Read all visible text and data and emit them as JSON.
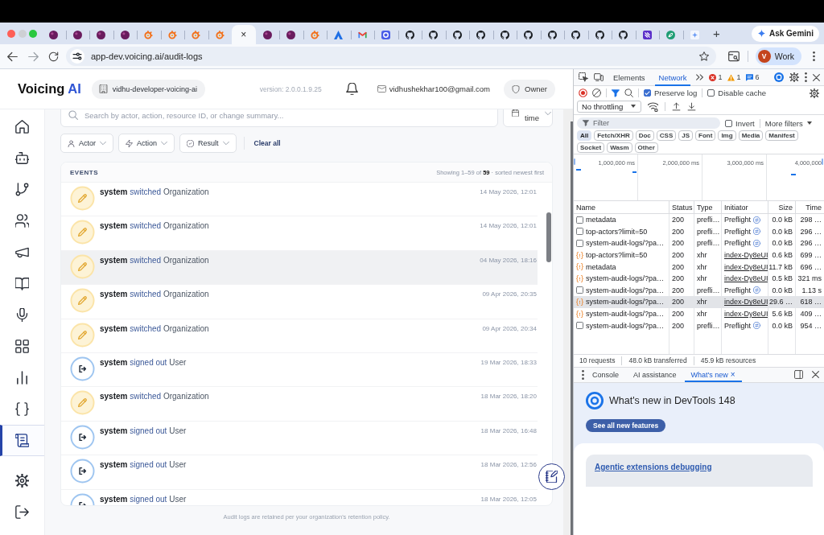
{
  "browser": {
    "tabs": [
      {
        "kind": "orb",
        "selected": false
      },
      {
        "kind": "orb",
        "selected": false
      },
      {
        "kind": "orb",
        "selected": false
      },
      {
        "kind": "orb",
        "selected": false
      },
      {
        "kind": "swirl",
        "selected": false
      },
      {
        "kind": "swirl",
        "selected": false
      },
      {
        "kind": "swirl",
        "selected": false
      },
      {
        "kind": "swirl",
        "selected": false
      },
      {
        "selected": true,
        "close": "×"
      },
      {
        "kind": "orb",
        "selected": false
      },
      {
        "kind": "orb",
        "selected": false
      },
      {
        "kind": "swirl",
        "selected": false
      },
      {
        "kind": "triangle",
        "selected": false
      },
      {
        "kind": "envelope",
        "selected": false
      },
      {
        "kind": "square",
        "selected": false
      },
      {
        "kind": "cat",
        "selected": false
      },
      {
        "kind": "cat",
        "selected": false
      },
      {
        "kind": "cat",
        "selected": false
      },
      {
        "kind": "cat",
        "selected": false
      },
      {
        "kind": "cat",
        "selected": false
      },
      {
        "kind": "cat",
        "selected": false
      },
      {
        "kind": "cat",
        "selected": false
      },
      {
        "kind": "cat",
        "selected": false
      },
      {
        "kind": "cat",
        "selected": false
      },
      {
        "kind": "cat",
        "selected": false
      },
      {
        "kind": "tile",
        "selected": false
      },
      {
        "kind": "leaf",
        "selected": false
      },
      {
        "kind": "sparkle",
        "selected": false
      }
    ],
    "new_tab": "+",
    "assistant": "Ask Gemini",
    "url": "app-dev.voicing.ai/audit-logs",
    "profile": {
      "initial": "V",
      "label": "Work"
    }
  },
  "app": {
    "logo": {
      "text": "Voicing",
      "accent": "AI"
    },
    "org": "vidhu-developer-voicing-ai",
    "version": "version: 2.0.0.1.9.25",
    "email": "vidhushekhar100@gmail.com",
    "role": "Owner",
    "sidebar": {
      "items": [
        {
          "kind": "home",
          "selected": false
        },
        {
          "kind": "bot",
          "selected": false
        },
        {
          "kind": "branch",
          "selected": false
        },
        {
          "kind": "users",
          "selected": false
        },
        {
          "kind": "megaphone",
          "selected": false
        },
        {
          "kind": "book",
          "selected": false
        },
        {
          "kind": "mic",
          "selected": false
        },
        {
          "kind": "grid",
          "selected": false
        },
        {
          "kind": "chart",
          "selected": false
        },
        {
          "kind": "braces",
          "selected": false
        },
        {
          "kind": "scroll",
          "selected": true
        }
      ],
      "footer_items": [
        {
          "kind": "gear",
          "selected": false
        },
        {
          "kind": "logout",
          "selected": false
        }
      ]
    },
    "search": {
      "placeholder": "Search by actor, action, resource ID, or change summary..."
    },
    "time_filter": "time",
    "filters": [
      {
        "kind": "actor",
        "label": "Actor"
      },
      {
        "kind": "action",
        "label": "Action"
      },
      {
        "kind": "result",
        "label": "Result"
      }
    ],
    "clear": "Clear all",
    "events": {
      "title": "EVENTS",
      "summary": "Showing 1–59 of **59** · sorted newest first",
      "rows": [
        {
          "kind": "edit",
          "actor": "system",
          "action": "switched",
          "resource": "Organization",
          "time": "14 May 2026, 12:01",
          "hovered": false
        },
        {
          "kind": "edit",
          "actor": "system",
          "action": "switched",
          "resource": "Organization",
          "time": "14 May 2026, 12:01",
          "hovered": false
        },
        {
          "kind": "edit",
          "actor": "system",
          "action": "switched",
          "resource": "Organization",
          "time": "04 May 2026, 18:16",
          "hovered": true
        },
        {
          "kind": "edit",
          "actor": "system",
          "action": "switched",
          "resource": "Organization",
          "time": "09 Apr 2026, 20:35",
          "hovered": false
        },
        {
          "kind": "edit",
          "actor": "system",
          "action": "switched",
          "resource": "Organization",
          "time": "09 Apr 2026, 20:34",
          "hovered": false
        },
        {
          "kind": "logout",
          "actor": "system",
          "action": "signed out",
          "resource": "User",
          "time": "19 Mar 2026, 18:33",
          "hovered": false
        },
        {
          "kind": "edit",
          "actor": "system",
          "action": "switched",
          "resource": "Organization",
          "time": "18 Mar 2026, 18:20",
          "hovered": false
        },
        {
          "kind": "logout",
          "actor": "system",
          "action": "signed out",
          "resource": "User",
          "time": "18 Mar 2026, 16:48",
          "hovered": false
        },
        {
          "kind": "logout",
          "actor": "system",
          "action": "signed out",
          "resource": "User",
          "time": "18 Mar 2026, 12:56",
          "hovered": false
        },
        {
          "kind": "logout",
          "actor": "system",
          "action": "signed out",
          "resource": "User",
          "time": "18 Mar 2026, 12:05",
          "hovered": false
        }
      ]
    },
    "footer": "Audit logs are retained per your organization's retention policy."
  },
  "devtools": {
    "panel_tabs": [
      {
        "label": "Elements",
        "selected": false
      },
      {
        "label": "Network",
        "selected": true
      }
    ],
    "issues": [
      {
        "kind": "error",
        "count": "1"
      },
      {
        "kind": "warning",
        "count": "1"
      },
      {
        "kind": "info",
        "count": "6"
      }
    ],
    "options": [
      {
        "label": "Preserve log",
        "checked": true
      },
      {
        "label": "Disable cache",
        "checked": false
      }
    ],
    "throttling": "No throttling",
    "filter": {
      "placeholder": "Filter"
    },
    "invert": {
      "label": "Invert",
      "checked": false
    },
    "more_filters": "More filters",
    "types": [
      {
        "label": "All",
        "selected": true
      },
      {
        "label": "Fetch/XHR",
        "selected": false
      },
      {
        "label": "Doc",
        "selected": false
      },
      {
        "label": "CSS",
        "selected": false
      },
      {
        "label": "JS",
        "selected": false
      },
      {
        "label": "Font",
        "selected": false
      },
      {
        "label": "Img",
        "selected": false
      },
      {
        "label": "Media",
        "selected": false
      },
      {
        "label": "Manifest",
        "selected": false
      },
      {
        "label": "Socket",
        "selected": false
      },
      {
        "label": "Wasm",
        "selected": false
      },
      {
        "label": "Other",
        "selected": false
      }
    ],
    "overview_ticks": [
      "1,000,000 ms",
      "2,000,000 ms",
      "3,000,000 ms",
      "4,000,000"
    ],
    "columns": [
      "Name",
      "Status",
      "Type",
      "Initiator",
      "Size",
      "Time"
    ],
    "requests": [
      {
        "kind": "preflight",
        "name": "metadata",
        "status": "200",
        "type": "prefli…",
        "initiator": "Preflight",
        "size": "0.0 kB",
        "time": "298 …",
        "selected": false
      },
      {
        "kind": "preflight",
        "name": "top-actors?limit=50",
        "status": "200",
        "type": "prefli…",
        "initiator": "Preflight",
        "size": "0.0 kB",
        "time": "296 …",
        "selected": false
      },
      {
        "kind": "preflight",
        "name": "system-audit-logs/?pa…",
        "status": "200",
        "type": "prefli…",
        "initiator": "Preflight",
        "size": "0.0 kB",
        "time": "296 …",
        "selected": false
      },
      {
        "kind": "xhr",
        "name": "top-actors?limit=50",
        "status": "200",
        "type": "xhr",
        "initiator": "index-Dy8eUI",
        "size": "0.6 kB",
        "time": "699 …",
        "selected": false
      },
      {
        "kind": "xhr",
        "name": "metadata",
        "status": "200",
        "type": "xhr",
        "initiator": "index-Dy8eUI",
        "size": "11.7 kB",
        "time": "696 …",
        "selected": false
      },
      {
        "kind": "xhr",
        "name": "system-audit-logs/?pa…",
        "status": "200",
        "type": "xhr",
        "initiator": "index-Dy8eUI",
        "size": "0.5 kB",
        "time": "321 ms",
        "selected": false
      },
      {
        "kind": "preflight",
        "name": "system-audit-logs/?pa…",
        "status": "200",
        "type": "prefli…",
        "initiator": "Preflight",
        "size": "0.0 kB",
        "time": "1.13 s",
        "selected": false
      },
      {
        "kind": "xhr",
        "name": "system-audit-logs/?pa…",
        "status": "200",
        "type": "xhr",
        "initiator": "index-Dy8eUI",
        "size": "29.6 …",
        "time": "618 …",
        "selected": true
      },
      {
        "kind": "xhr",
        "name": "system-audit-logs/?pa…",
        "status": "200",
        "type": "xhr",
        "initiator": "index-Dy8eUI",
        "size": "5.6 kB",
        "time": "409 …",
        "selected": false
      },
      {
        "kind": "preflight",
        "name": "system-audit-logs/?pa…",
        "status": "200",
        "type": "prefli…",
        "initiator": "Preflight",
        "size": "0.0 kB",
        "time": "954 …",
        "selected": false
      }
    ],
    "summary": [
      "10 requests",
      "48.0 kB transferred",
      "45.9 kB resources"
    ],
    "drawer_tabs": [
      {
        "label": "Console",
        "selected": false
      },
      {
        "label": "AI assistance",
        "selected": false
      },
      {
        "label": "What's new",
        "selected": true,
        "close": "×"
      }
    ],
    "whats_new": {
      "title": "What's new in DevTools 148",
      "button": "See all new features",
      "card_link": "Agentic extensions debugging"
    }
  }
}
